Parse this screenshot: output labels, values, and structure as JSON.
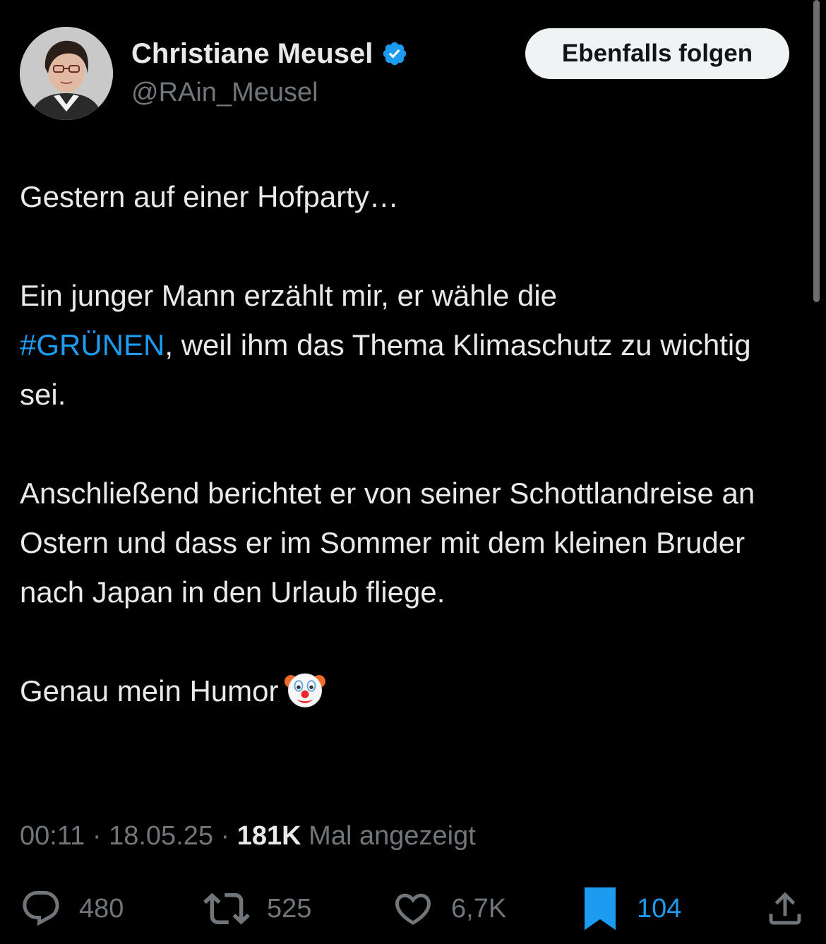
{
  "author": {
    "display_name": "Christiane Meusel",
    "handle": "@RAin_Meusel",
    "verified": true
  },
  "follow_button": {
    "label": "Ebenfalls folgen"
  },
  "tweet": {
    "line1": "Gestern auf einer Hofparty…",
    "p2_start": "Ein junger Mann erzählt mir, er wähle die",
    "hashtag": "#GRÜNEN",
    "p2_end": ", weil ihm das Thema Klimaschutz zu wichtig sei.",
    "p3": "Anschließend berichtet er von seiner Schottlandreise an Ostern und dass er im Sommer mit dem kleinen Bruder nach Japan in den Urlaub fliege.",
    "p4": "Genau mein Humor",
    "emoji": "clown-face"
  },
  "meta": {
    "time": "00:11",
    "sep1": " · ",
    "date": "18.05.25",
    "sep2": " · ",
    "views": "181K",
    "views_label": " Mal angezeigt"
  },
  "actions": {
    "replies": "480",
    "reposts": "525",
    "likes": "6,7K",
    "bookmarks": "104"
  },
  "icons": [
    "verified-badge-icon",
    "reply-icon",
    "repost-icon",
    "like-icon",
    "bookmark-icon",
    "share-icon"
  ],
  "colors": {
    "background": "#000000",
    "text": "#e7e9ea",
    "secondary": "#71767b",
    "accent": "#1d9bf0",
    "button_bg": "#eff3f4"
  }
}
